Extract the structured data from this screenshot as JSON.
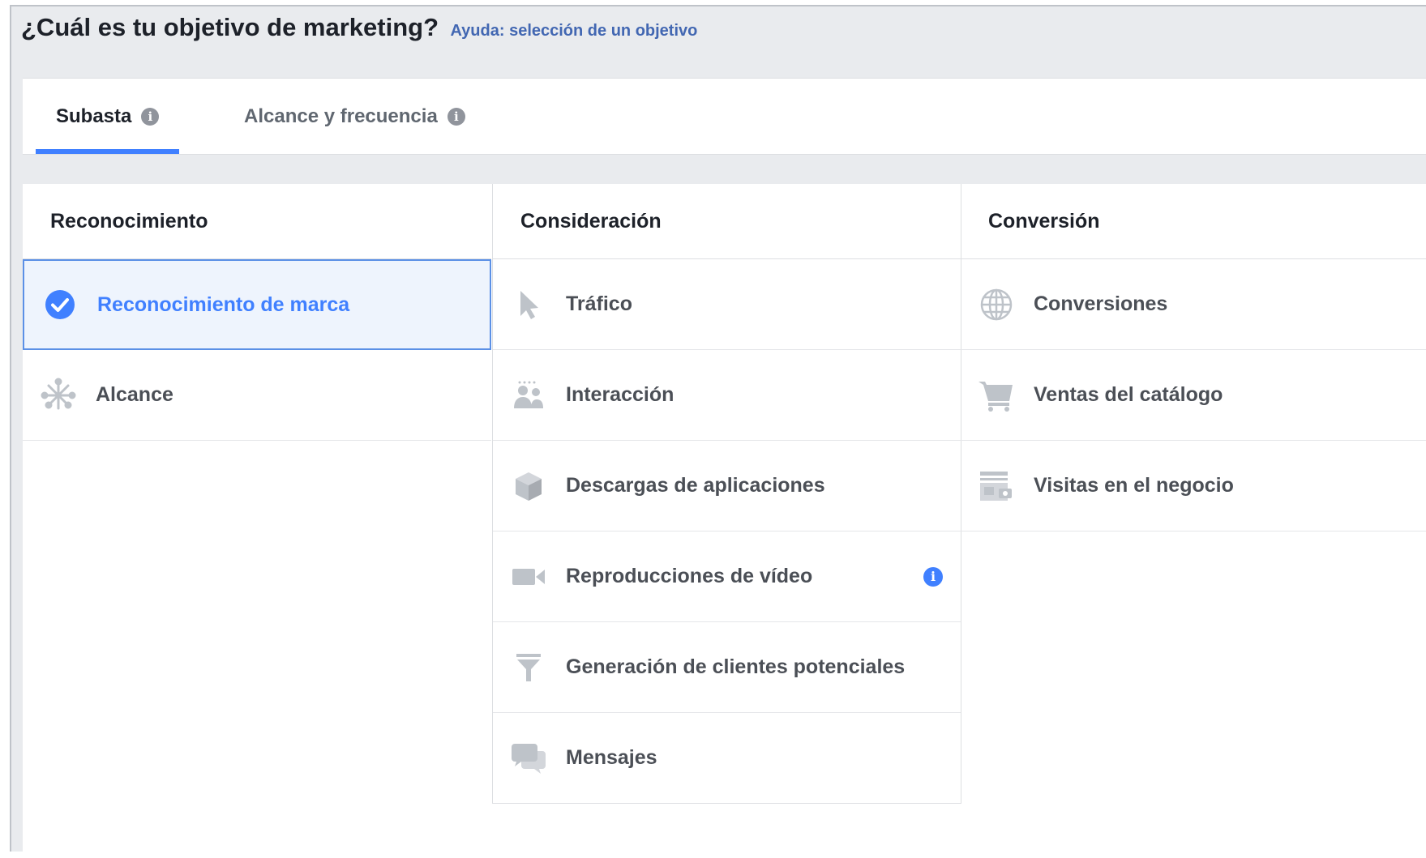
{
  "heading": {
    "title": "¿Cuál es tu objetivo de marketing?",
    "help_link": "Ayuda: selección de un objetivo"
  },
  "tabs": [
    {
      "label": "Subasta",
      "selected": true
    },
    {
      "label": "Alcance y frecuencia",
      "selected": false
    }
  ],
  "columns": [
    {
      "title": "Reconocimiento",
      "items": [
        {
          "label": "Reconocimiento de marca",
          "icon": "check-circle-icon",
          "selected": true
        },
        {
          "label": "Alcance",
          "icon": "reach-burst-icon"
        }
      ]
    },
    {
      "title": "Consideración",
      "items": [
        {
          "label": "Tráfico",
          "icon": "cursor-icon"
        },
        {
          "label": "Interacción",
          "icon": "people-icon"
        },
        {
          "label": "Descargas de aplicaciones",
          "icon": "box-icon"
        },
        {
          "label": "Reproducciones de vídeo",
          "icon": "video-camera-icon",
          "info": true
        },
        {
          "label": "Generación de clientes potenciales",
          "icon": "funnel-icon"
        },
        {
          "label": "Mensajes",
          "icon": "chat-bubbles-icon"
        }
      ]
    },
    {
      "title": "Conversión",
      "items": [
        {
          "label": "Conversiones",
          "icon": "globe-icon"
        },
        {
          "label": "Ventas del catálogo",
          "icon": "shopping-cart-icon"
        },
        {
          "label": "Visitas en el negocio",
          "icon": "storefront-icon"
        }
      ]
    }
  ],
  "colors": {
    "accent": "#4080ff",
    "selected_bg": "#eef4fd",
    "icon_gray": "#bec3c9"
  }
}
